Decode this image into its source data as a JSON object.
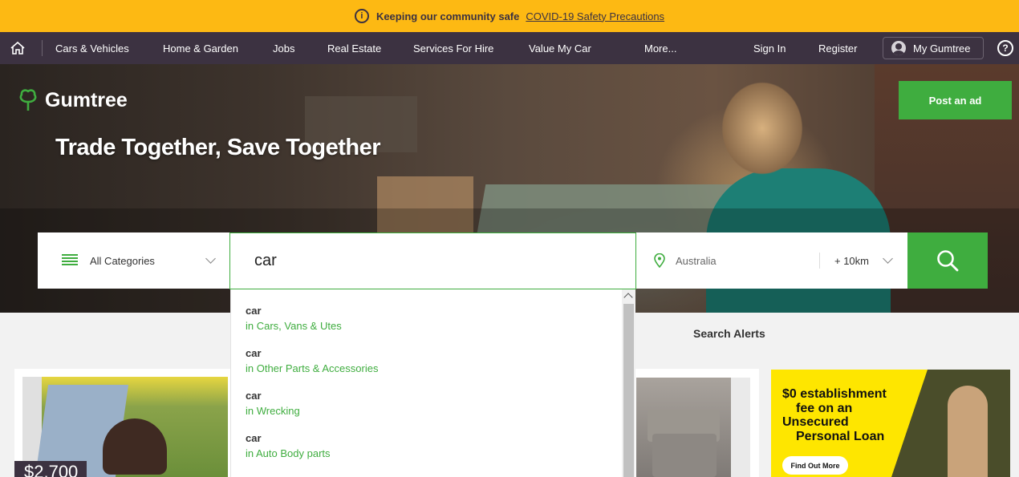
{
  "covid_banner": {
    "strong": "Keeping our community safe",
    "link": "COVID-19 Safety Precautions"
  },
  "nav": {
    "items": [
      "Cars & Vehicles",
      "Home & Garden",
      "Jobs",
      "Real Estate",
      "Services For Hire",
      "Value My Car",
      "More..."
    ],
    "sign_in": "Sign In",
    "register": "Register",
    "my_gumtree": "My Gumtree",
    "help": "?"
  },
  "brand": {
    "name": "Gumtree",
    "accent": "#3fad3f",
    "nav_bg": "#3c3241",
    "banner_bg": "#fdb913"
  },
  "hero": {
    "tagline": "Trade Together, Save Together",
    "post_ad": "Post an ad"
  },
  "search": {
    "category": "All Categories",
    "query": "car",
    "location_placeholder": "Australia",
    "radius": "+ 10km"
  },
  "suggestions": [
    {
      "term": "car",
      "category": "in Cars, Vans & Utes"
    },
    {
      "term": "car",
      "category": "in Other Parts & Accessories"
    },
    {
      "term": "car",
      "category": "in Wrecking"
    },
    {
      "term": "car",
      "category": "in Auto Body parts"
    }
  ],
  "search_alerts": "Search Alerts",
  "listing": {
    "price": "$2,700"
  },
  "ad": {
    "line1": "$0 establishment",
    "line2": "fee on an",
    "line3": "Unsecured",
    "line4": "Personal Loan",
    "cta": "Find Out More"
  }
}
